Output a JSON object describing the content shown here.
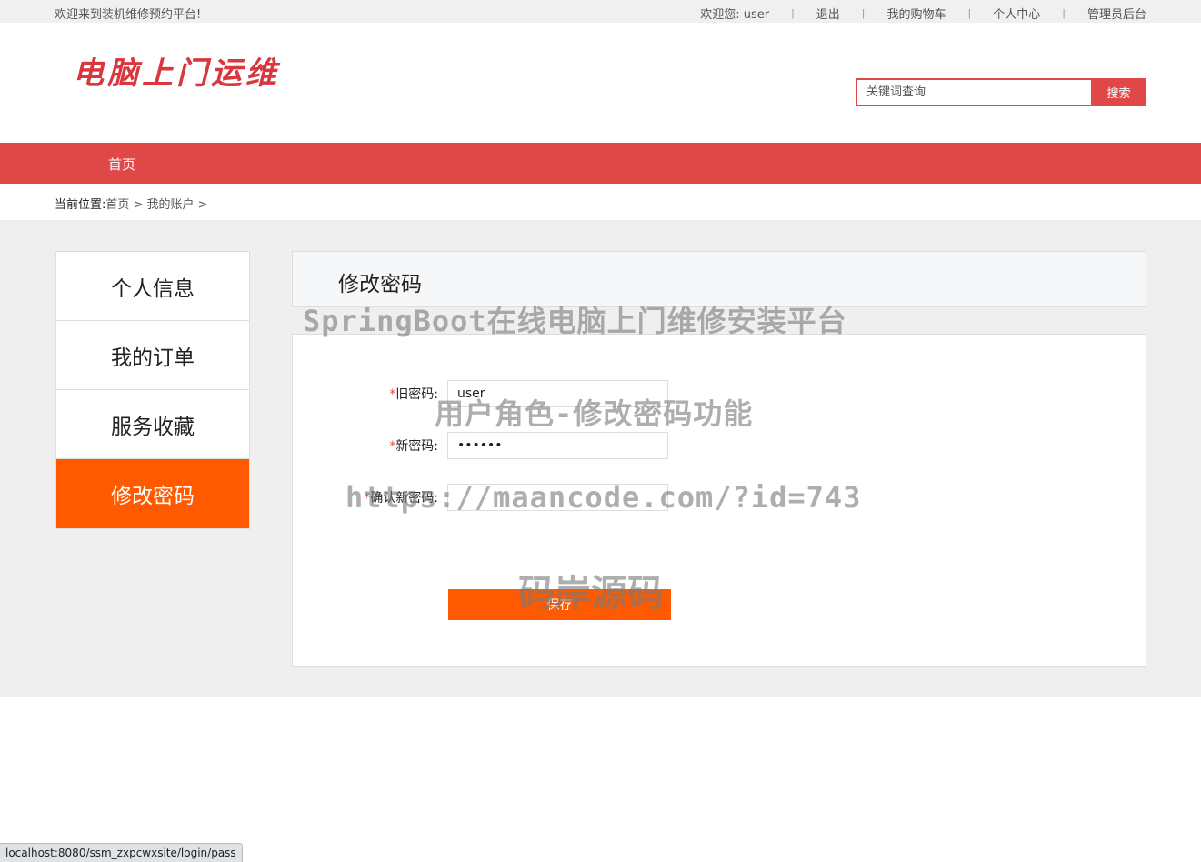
{
  "topbar": {
    "welcome": "欢迎来到装机维修预约平台!",
    "user_greeting": "欢迎您: user",
    "logout": "退出",
    "cart": "我的购物车",
    "profile": "个人中心",
    "admin": "管理员后台"
  },
  "header": {
    "logo": "电脑上门运维",
    "search_placeholder": "关键词查询",
    "search_button": "搜索"
  },
  "nav": {
    "home": "首页"
  },
  "breadcrumb": {
    "label": "当前位置:",
    "path": "首页 > 我的账户 >"
  },
  "sidebar": {
    "items": [
      {
        "label": "个人信息",
        "active": false
      },
      {
        "label": "我的订单",
        "active": false
      },
      {
        "label": "服务收藏",
        "active": false
      },
      {
        "label": "修改密码",
        "active": true
      }
    ]
  },
  "panel": {
    "title": "修改密码",
    "fields": {
      "old_label": "旧密码:",
      "old_value": "user",
      "new_label": "新密码:",
      "new_value": "••••••",
      "confirm_label": "确认新密码:",
      "confirm_value": ""
    },
    "required_mark": "*",
    "save_button": "保存"
  },
  "watermarks": {
    "line1": "SpringBoot在线电脑上门维修安装平台",
    "line2": "用户角色-修改密码功能",
    "line3": "https://maancode.com/?id=743",
    "line4": "码岸源码"
  },
  "statusbar": {
    "url": "localhost:8080/ssm_zxpcwxsite/login/pass"
  },
  "colors": {
    "brand_red": "#e04848",
    "accent_orange": "#ff5a00"
  }
}
